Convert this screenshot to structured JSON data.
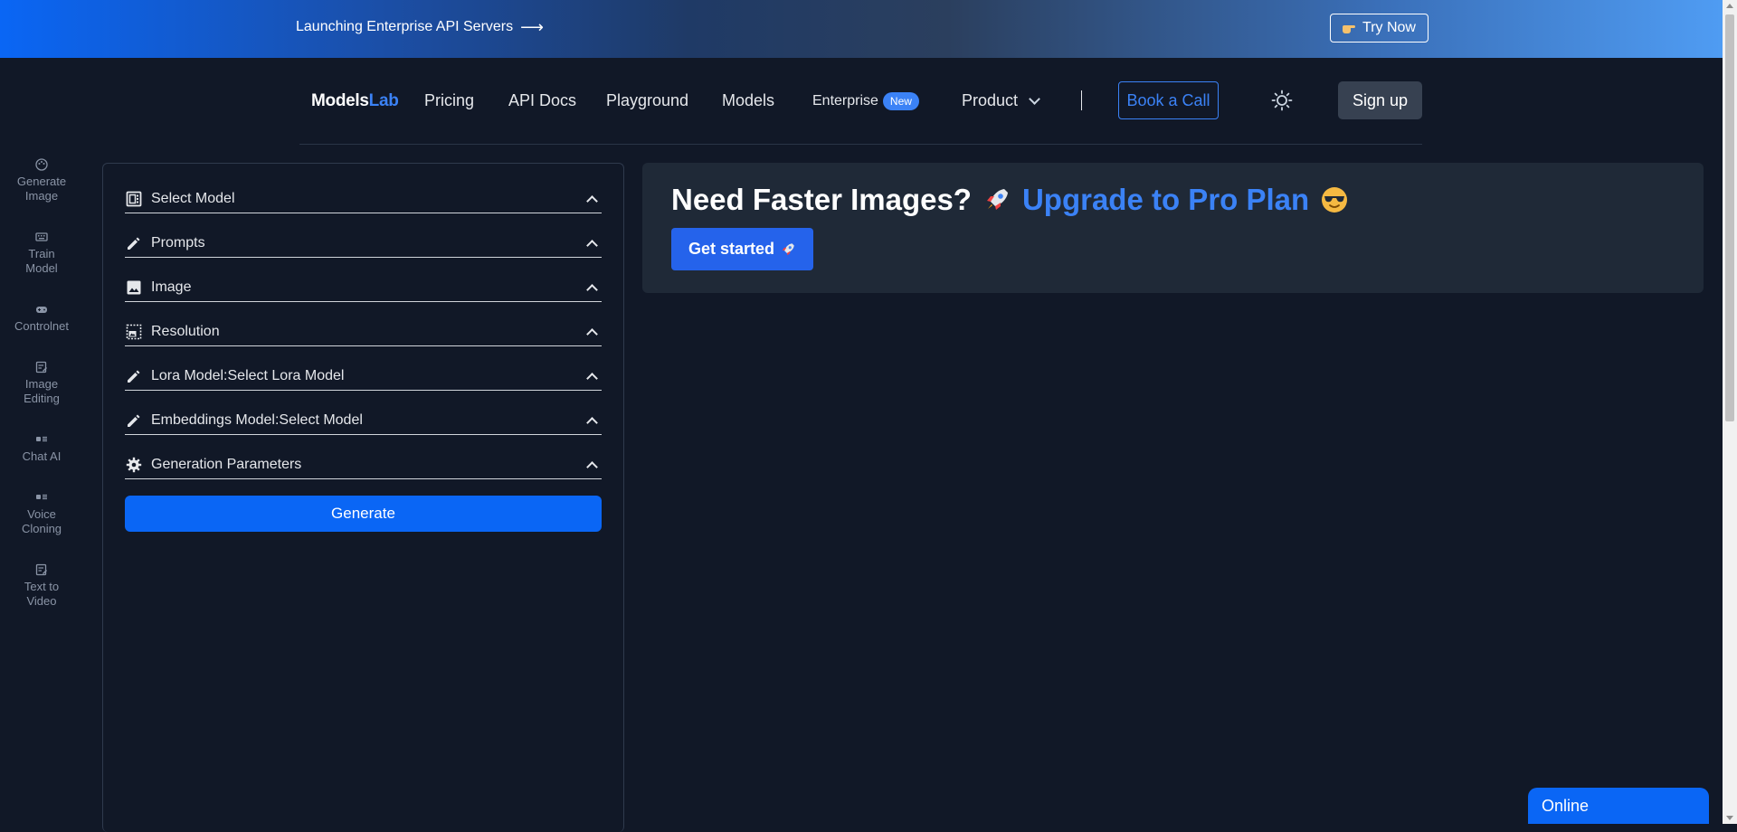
{
  "banner": {
    "announcement": "Launching Enterprise API Servers",
    "arrow": "⟶",
    "try_now": "Try Now"
  },
  "nav": {
    "logo_main": "Models",
    "logo_accent": "Lab",
    "pricing": "Pricing",
    "api_docs": "API Docs",
    "playground": "Playground",
    "models": "Models",
    "enterprise": "Enterprise",
    "enterprise_badge": "New",
    "product": "Product",
    "book_call": "Book a Call",
    "sign_up": "Sign up"
  },
  "sidebar": {
    "items": [
      {
        "label_line1": "Generate",
        "label_line2": "Image",
        "icon": "palette-icon"
      },
      {
        "label_line1": "Train",
        "label_line2": "Model",
        "icon": "keyboard-icon"
      },
      {
        "label_line1": "Controlnet",
        "label_line2": "",
        "icon": "gamepad-icon"
      },
      {
        "label_line1": "Image",
        "label_line2": "Editing",
        "icon": "edit-note-icon"
      },
      {
        "label_line1": "Chat AI",
        "label_line2": "",
        "icon": "chat-icon"
      },
      {
        "label_line1": "Voice",
        "label_line2": "Cloning",
        "icon": "voice-icon"
      },
      {
        "label_line1": "Text to",
        "label_line2": "Video",
        "icon": "edit-note-icon"
      }
    ]
  },
  "form": {
    "sections": [
      {
        "label": "Select Model",
        "icon": "model-select-icon"
      },
      {
        "label": "Prompts",
        "icon": "pencil-icon"
      },
      {
        "label": "Image",
        "icon": "image-icon"
      },
      {
        "label": "Resolution",
        "icon": "resolution-icon"
      },
      {
        "label": "Lora Model:Select Lora Model",
        "icon": "pencil-icon"
      },
      {
        "label": "Embeddings Model:Select Model",
        "icon": "pencil-icon"
      },
      {
        "label": "Generation Parameters",
        "icon": "gear-icon"
      }
    ],
    "generate": "Generate"
  },
  "promo": {
    "headline": "Need Faster Images?",
    "upgrade": "Upgrade to Pro Plan",
    "cta": "Get started"
  },
  "chat_widget": {
    "status": "Online"
  },
  "colors": {
    "background": "#111827",
    "card": "#1f2937",
    "accent": "#3b82f6",
    "primary_button": "#0a66f5"
  }
}
